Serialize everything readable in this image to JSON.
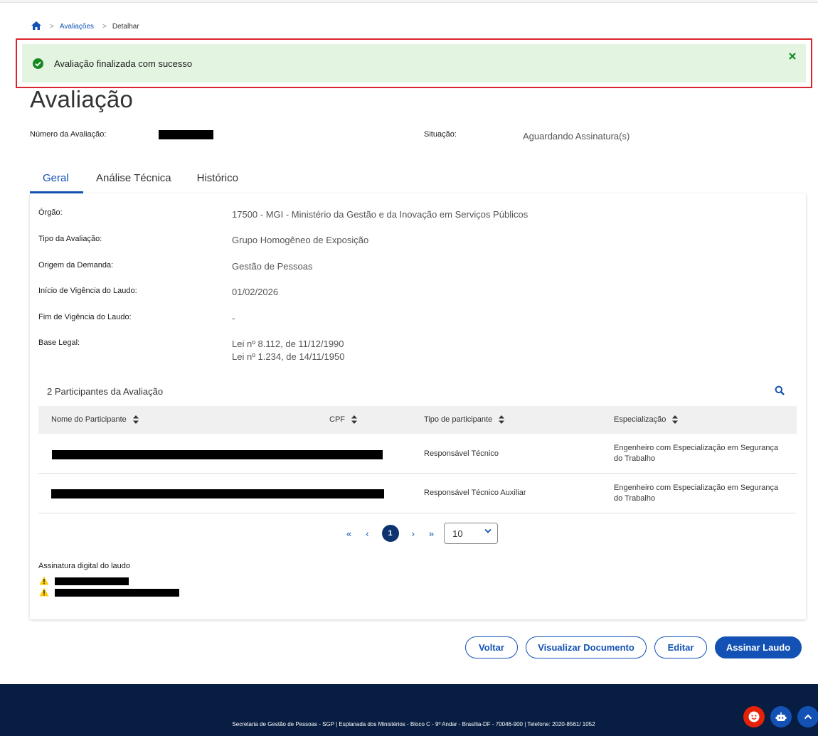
{
  "breadcrumb": {
    "home_icon": "home-icon",
    "items": [
      "Avaliações",
      "Detalhar"
    ]
  },
  "alert": {
    "message": "Avaliação finalizada com sucesso",
    "status_color": "#168821",
    "icon": "check-circle-icon",
    "close_icon": "close-icon"
  },
  "page": {
    "title": "Avaliação"
  },
  "meta": {
    "numero_label": "Número da Avaliação:",
    "situacao_label": "Situação:",
    "situacao_value": "Aguardando Assinatura(s)"
  },
  "tabs": [
    {
      "label": "Geral",
      "active": true
    },
    {
      "label": "Análise Técnica",
      "active": false
    },
    {
      "label": "Histórico",
      "active": false
    }
  ],
  "details": {
    "orgao_label": "Órgão:",
    "orgao_value": "17500 - MGI - Ministério da Gestão e da Inovação em Serviços Públicos",
    "tipo_label": "Tipo da Avaliação:",
    "tipo_value": "Grupo Homogêneo de Exposição",
    "origem_label": "Origem da Demanda:",
    "origem_value": "Gestão de Pessoas",
    "inicio_label": "Início de Vigência do Laudo:",
    "inicio_value": "01/02/2026",
    "fim_label": "Fim de Vigência do Laudo:",
    "fim_value": "-",
    "base_label": "Base Legal:",
    "base_values": [
      "Lei nº 8.112, de 11/12/1990",
      "Lei nº 1.234, de 14/11/1950"
    ]
  },
  "participants": {
    "title": "2 Participantes da Avaliação",
    "columns": [
      "Nome do Participante",
      "CPF",
      "Tipo de participante",
      "Especialização"
    ],
    "rows": [
      {
        "tipo": "Responsável Técnico",
        "especializacao": [
          "Engenheiro com Especialização em Segurança",
          "do Trabalho"
        ]
      },
      {
        "tipo": "Responsável Técnico Auxiliar",
        "especializacao": [
          "Engenheiro com Especialização em Segurança",
          "do Trabalho"
        ]
      }
    ]
  },
  "pagination": {
    "first": "«",
    "prev": "‹",
    "current": "1",
    "next": "›",
    "last": "»",
    "page_size": "10"
  },
  "signature": {
    "title": "Assinatura digital do laudo",
    "warning_icon": "warning-icon"
  },
  "actions": {
    "voltar": "Voltar",
    "visualizar": "Visualizar Documento",
    "editar": "Editar",
    "assinar": "Assinar Laudo"
  },
  "footer": {
    "text": "Secretaria de Gestão de Pessoas - SGP | Esplanada dos Ministérios - Bloco C - 9º Andar - Brasília-DF - 70046-900 | Telefone: 2020-8561/ 1052"
  },
  "colors": {
    "primary": "#1351b4",
    "footer_bg": "#071d41",
    "alert_bg": "#e3f5e1",
    "highlight": "#d9262e"
  }
}
